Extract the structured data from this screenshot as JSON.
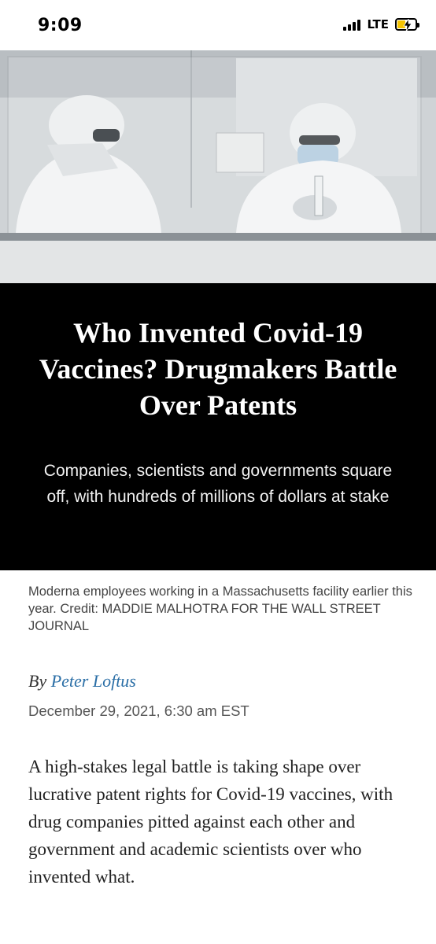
{
  "status_bar": {
    "time": "9:09",
    "network": "LTE",
    "battery_level": 0.4,
    "battery_color": "#f5c400",
    "signal_icon": "signal-bars-icon",
    "battery_icon": "battery-charging-icon"
  },
  "hero": {
    "image": "lab-workers-photo"
  },
  "article": {
    "headline": "Who Invented Covid-19 Vaccines? Drugmakers Battle Over Patents",
    "dek": "Companies, scientists and governments square off, with hundreds of millions of dollars at stake",
    "caption": "Moderna employees working in a Massachusetts facility earlier this year. Credit: MADDIE MALHOTRA FOR THE WALL STREET JOURNAL",
    "byline_prefix": "By",
    "author": "Peter Loftus",
    "date": "December 29, 2021, 6:30 am EST",
    "body": "A high-stakes legal battle is taking shape over lucrative patent rights for Covid-19 vaccines, with drug companies pitted against each other and government and academic scientists over who invented what."
  },
  "colors": {
    "headline_background": "#000000",
    "author_link": "#2a6ea6"
  }
}
